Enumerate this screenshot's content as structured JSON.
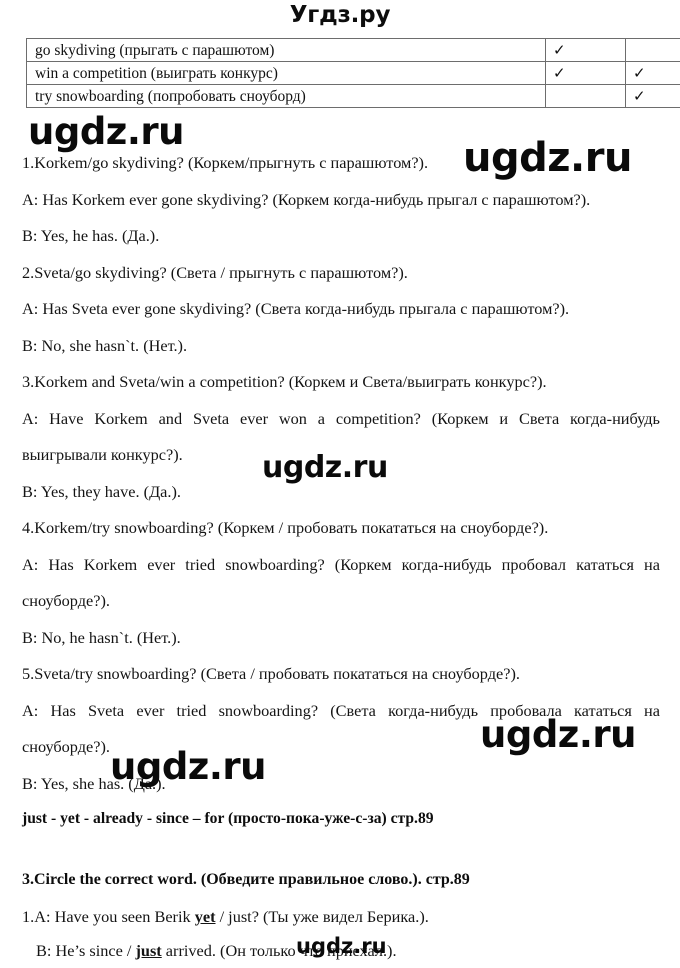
{
  "site": {
    "header_title": "Угдз.ру",
    "watermark_text": "ugdz.ru"
  },
  "table": {
    "rows": [
      {
        "activity": "go skydiving (прыгать с парашютом)",
        "person1": "✓",
        "person2": ""
      },
      {
        "activity": "win a competition (выиграть конкурс)",
        "person1": "✓",
        "person2": "✓"
      },
      {
        "activity": "try snowboarding (попробовать сноуборд)",
        "person1": "",
        "person2": "✓"
      }
    ]
  },
  "body": {
    "lines": [
      "1.Korkem/go skydiving? (Коркем/прыгнуть с парашютом?).",
      "A: Has Korkem ever gone skydiving? (Коркем когда-нибудь прыгал с парашютом?).",
      "B: Yes, he has. (Да.).",
      "2.Sveta/go skydiving? (Света / прыгнуть с парашютом?).",
      "A: Has Sveta ever gone skydiving? (Света когда-нибудь прыгала с парашютом?).",
      "B: No, she hasn`t. (Нет.).",
      "3.Korkem and Sveta/win a competition? (Коркем и Света/выиграть конкурс?).",
      "A: Have Korkem and Sveta ever won a competition? (Коркем и Света когда-нибудь выигрывали конкурс?).",
      "B: Yes, they have. (Да.).",
      "4.Korkem/try snowboarding? (Коркем / пробовать покататься на сноуборде?).",
      "A: Has Korkem ever tried snowboarding? (Коркем когда-нибудь пробовал кататься на сноуборде?).",
      "B: No, he hasn`t. (Нет.).",
      "5.Sveta/try snowboarding? (Света / пробовать покататься на сноуборде?).",
      "A: Has Sveta ever tried snowboarding? (Света когда-нибудь пробовала кататься на сноуборде?).",
      "B: Yes, she has. (Да.)."
    ]
  },
  "keywords_line": "just - yet - already - since – for (просто-пока-уже-с-за) стр.89",
  "task3": {
    "heading": "3.Circle the correct word. (Обведите правильное слово.). стр.89",
    "line1": {
      "prefix": "1.A: Have you seen Berik ",
      "bold": "yet",
      "suffix": " / just? (Ты уже видел Берика.)."
    },
    "line2": {
      "prefix": "B: He’s since / ",
      "bold": "just",
      "suffix": " arrived. (Он только что приехал.)."
    }
  }
}
